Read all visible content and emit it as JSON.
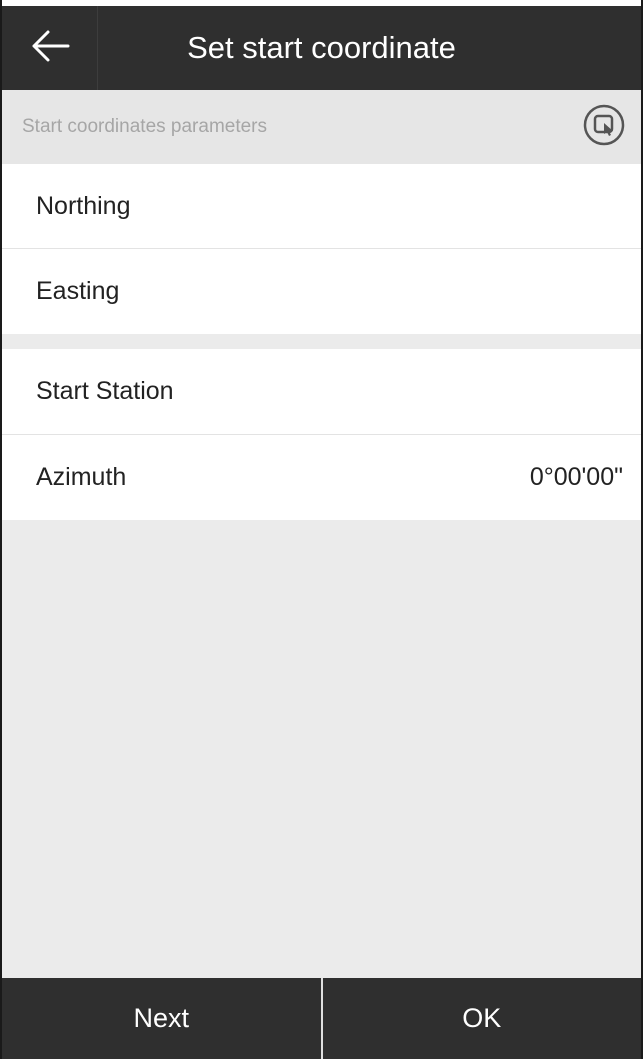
{
  "header": {
    "title": "Set start coordinate",
    "back_icon": "arrow-left-icon"
  },
  "section": {
    "label": "Start coordinates parameters",
    "action_icon": "select-point-icon"
  },
  "fields": [
    {
      "label": "Northing",
      "value": ""
    },
    {
      "label": "Easting",
      "value": ""
    },
    {
      "label": "Start Station",
      "value": ""
    },
    {
      "label": "Azimuth",
      "value": "0°00'00\""
    }
  ],
  "footer": {
    "next_label": "Next",
    "ok_label": "OK"
  },
  "colors": {
    "header_bg": "#2f2f2f",
    "page_bg": "#ebebeb",
    "row_bg": "#ffffff"
  }
}
